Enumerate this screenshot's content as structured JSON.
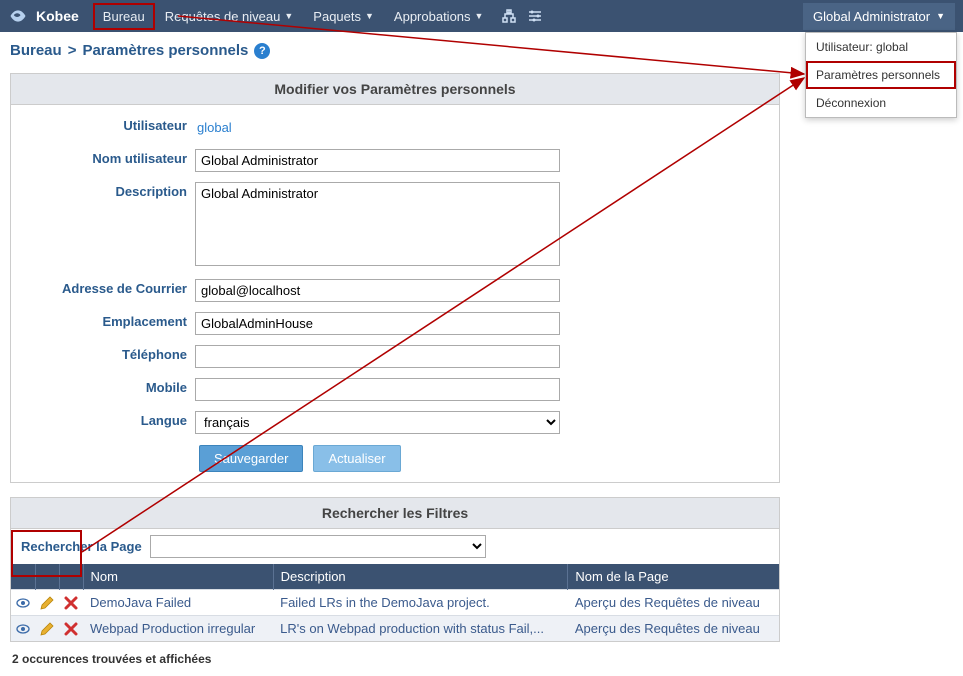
{
  "brand": "Kobee",
  "nav": {
    "bureau": "Bureau",
    "requetes": "Requêtes de niveau",
    "paquets": "Paquets",
    "approbations": "Approbations"
  },
  "user_btn": "Global Administrator",
  "dropdown": {
    "user": "Utilisateur: global",
    "params": "Paramètres personnels",
    "logout": "Déconnexion"
  },
  "breadcrumb": {
    "a": "Bureau",
    "b": "Paramètres personnels"
  },
  "form": {
    "title": "Modifier vos Paramètres personnels",
    "labels": {
      "user": "Utilisateur",
      "username": "Nom utilisateur",
      "desc": "Description",
      "email": "Adresse de Courrier",
      "loc": "Emplacement",
      "tel": "Téléphone",
      "mobile": "Mobile",
      "lang": "Langue"
    },
    "values": {
      "user": "global",
      "username": "Global Administrator",
      "desc": "Global Administrator",
      "email": "global@localhost",
      "loc": "GlobalAdminHouse",
      "tel": "",
      "mobile": "",
      "lang": "français"
    },
    "buttons": {
      "save": "Sauvegarder",
      "refresh": "Actualiser"
    }
  },
  "filters": {
    "title": "Rechercher les Filtres",
    "search_label": "Rechercher la Page",
    "search_value": "",
    "cols": {
      "nom": "Nom",
      "desc": "Description",
      "page": "Nom de la Page"
    },
    "rows": [
      {
        "nom": "DemoJava Failed",
        "desc": "Failed LRs in the DemoJava project.",
        "page": "Aperçu des Requêtes de niveau"
      },
      {
        "nom": "Webpad Production irregular",
        "desc": "LR's on Webpad production with status Fail,...",
        "page": "Aperçu des Requêtes de niveau"
      }
    ],
    "status": "2 occurences trouvées et affichées"
  }
}
